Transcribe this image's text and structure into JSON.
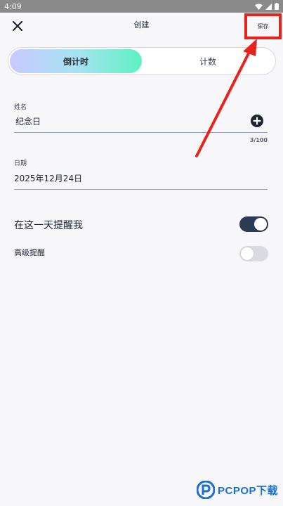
{
  "status_bar": {
    "time": "4:09"
  },
  "header": {
    "title": "创建",
    "save_label": "保存",
    "close_icon": "close-icon"
  },
  "tabs": [
    {
      "label": "倒计时",
      "active": true
    },
    {
      "label": "计数",
      "active": false
    }
  ],
  "form": {
    "name_label": "姓名",
    "name_value": "纪念日",
    "name_counter": "3/100",
    "date_label": "日期",
    "date_value": "2025年12月24日"
  },
  "settings": {
    "remind_label": "在这一天提醒我",
    "remind_on": true,
    "advanced_label": "高级提醒",
    "advanced_on": false
  },
  "watermark": {
    "text": "PCPOP下载"
  },
  "colors": {
    "annotation": "#e8221d",
    "toggle_on": "#2b3a55",
    "toggle_off": "#d9dbe0",
    "tab_gradient_start": "#c9c9ff",
    "tab_gradient_end": "#5ff0c2",
    "watermark": "#1a6fd1"
  }
}
